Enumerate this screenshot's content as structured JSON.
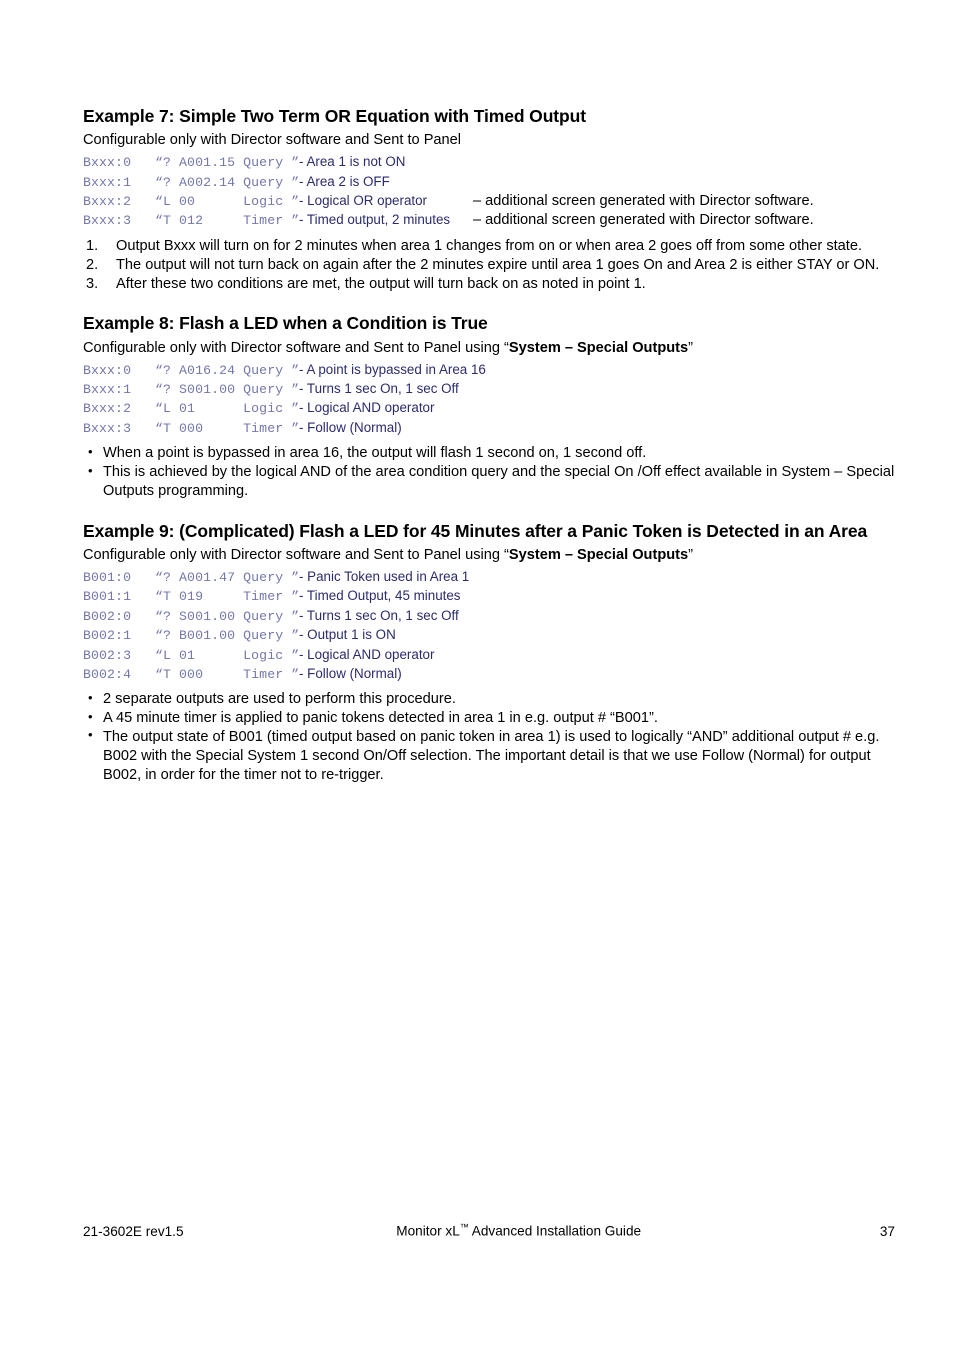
{
  "document": {
    "title": "Monitor xL™ Advanced Installation Guide",
    "page_number": "37",
    "doc_code": "21-3602E rev1.5"
  },
  "footer": {
    "left": "21-3602E rev1.5",
    "center_pre": "Monitor xL",
    "center_tm": "™",
    "center_post": " Advanced Installation Guide",
    "right": "37"
  },
  "colors": {
    "code_mono": "#7477ad",
    "code_description": "#2b2b6e",
    "body_text": "#000000",
    "page_background": "#ffffff"
  },
  "examples": [
    {
      "id": "example-7",
      "heading": "Example 7: Simple Two Term OR Equation with Timed Output",
      "subtitle_plain": "Configurable only with Director software and Sent to Panel",
      "subtitle_bold": "",
      "subtitle_suffix": "",
      "code_rows": [
        {
          "label": "Bxxx:0",
          "expr": "“? A001.15 Query ”",
          "description": "- Area 1 is not ON",
          "note": ""
        },
        {
          "label": "Bxxx:1",
          "expr": "“? A002.14 Query ”",
          "description": "- Area 2 is OFF",
          "note": ""
        },
        {
          "label": "Bxxx:2",
          "expr": "“L 00      Logic ”",
          "description": "- Logical OR operator",
          "note": "–  additional screen generated with Director software."
        },
        {
          "label": "Bxxx:3",
          "expr": "“T 012     Timer ”",
          "description": "- Timed output, 2 minutes",
          "note": "–  additional screen generated with Director software."
        }
      ],
      "numbered_list": [
        {
          "marker": "1.",
          "text": "Output Bxxx will turn on for 2 minutes when area 1 changes from on or when area 2 goes off from some other state."
        },
        {
          "marker": "2.",
          "text": "The output will not turn back on again after the 2 minutes expire until area 1 goes On and Area 2 is either STAY or ON."
        },
        {
          "marker": "3.",
          "text": "After these two conditions are met, the output will turn back on as noted in point 1."
        }
      ],
      "bullet_list": []
    },
    {
      "id": "example-8",
      "heading": "Example 8: Flash a LED when a Condition is True",
      "subtitle_plain": "Configurable only with Director software and Sent to Panel using “",
      "subtitle_bold": "System – Special Outputs",
      "subtitle_suffix": "”",
      "code_rows": [
        {
          "label": "Bxxx:0",
          "expr": "“? A016.24 Query ”",
          "description": "- A point is bypassed in Area 16",
          "note": ""
        },
        {
          "label": "Bxxx:1",
          "expr": "“? S001.00 Query ”",
          "description": "- Turns 1 sec On, 1 sec Off",
          "note": ""
        },
        {
          "label": "Bxxx:2",
          "expr": "“L 01      Logic ”",
          "description": "- Logical AND operator",
          "note": ""
        },
        {
          "label": "Bxxx:3",
          "expr": "“T 000     Timer ”",
          "description": "- Follow (Normal)",
          "note": ""
        }
      ],
      "numbered_list": [],
      "bullet_list": [
        {
          "marker": "•",
          "text": "When a point is bypassed in area 16, the output will flash 1 second on, 1 second off."
        },
        {
          "marker": "•",
          "text": "This is achieved by the logical AND of the area condition query and the special On /Off effect available in System – Special Outputs programming."
        }
      ]
    },
    {
      "id": "example-9",
      "heading": "Example 9: (Complicated)  Flash a LED for 45 Minutes after a Panic Token is Detected in an Area",
      "subtitle_plain": "Configurable only with Director software and Sent to Panel using “",
      "subtitle_bold": "System – Special Outputs",
      "subtitle_suffix": "”",
      "code_rows": [
        {
          "label": "B001:0",
          "expr": "“? A001.47 Query ”",
          "description": "- Panic Token used in Area 1",
          "note": ""
        },
        {
          "label": "B001:1",
          "expr": "“T 019     Timer ”",
          "description": "- Timed Output, 45 minutes",
          "note": ""
        },
        {
          "label": "B002:0",
          "expr": "“? S001.00 Query ”",
          "description": "- Turns 1 sec On, 1 sec Off",
          "note": ""
        },
        {
          "label": "B002:1",
          "expr": "“? B001.00 Query ”",
          "description": "- Output 1 is ON",
          "note": ""
        },
        {
          "label": "B002:3",
          "expr": "“L 01      Logic ”",
          "description": "- Logical AND operator",
          "note": ""
        },
        {
          "label": "B002:4",
          "expr": "“T 000     Timer ”",
          "description": "- Follow (Normal)",
          "note": ""
        }
      ],
      "numbered_list": [],
      "bullet_list": [
        {
          "marker": "•",
          "text": "2 separate outputs are used to perform this procedure."
        },
        {
          "marker": "•",
          "text": "A 45 minute timer is applied to panic tokens detected in area 1 in e.g. output # “B001”."
        },
        {
          "marker": "•",
          "text": "The output state of B001 (timed output based on panic token in area 1) is used to logically “AND” additional output # e.g. B002 with the Special System 1 second On/Off selection. The important detail is that we use Follow (Normal) for output B002, in order for the timer not to re-trigger."
        }
      ]
    }
  ]
}
